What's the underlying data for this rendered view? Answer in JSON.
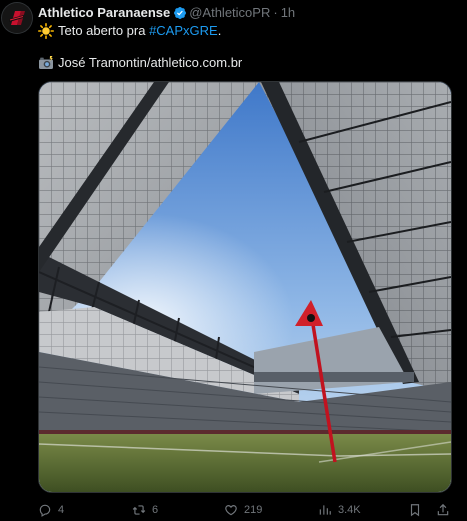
{
  "tweet": {
    "author_name": "Athletico Paranaense",
    "handle": "@AthleticoPR",
    "separator": "·",
    "time": "1h",
    "text_prefix": "Teto aberto pra ",
    "hashtag": "#CAPxGRE",
    "text_suffix": ".",
    "credit": "José Tramontin/athletico.com.br",
    "icons": {
      "sun_emoji": "sun-emoji",
      "camera_emoji": "camera-with-flash-emoji"
    },
    "colors": {
      "link": "#1d9bf0",
      "verified": "#1d9bf0",
      "muted": "#71767b",
      "text": "#e7e9ea",
      "corner_flag": "#d0202a"
    }
  },
  "actions": {
    "replies": "4",
    "retweets": "6",
    "likes": "219",
    "views": "3.4K"
  }
}
